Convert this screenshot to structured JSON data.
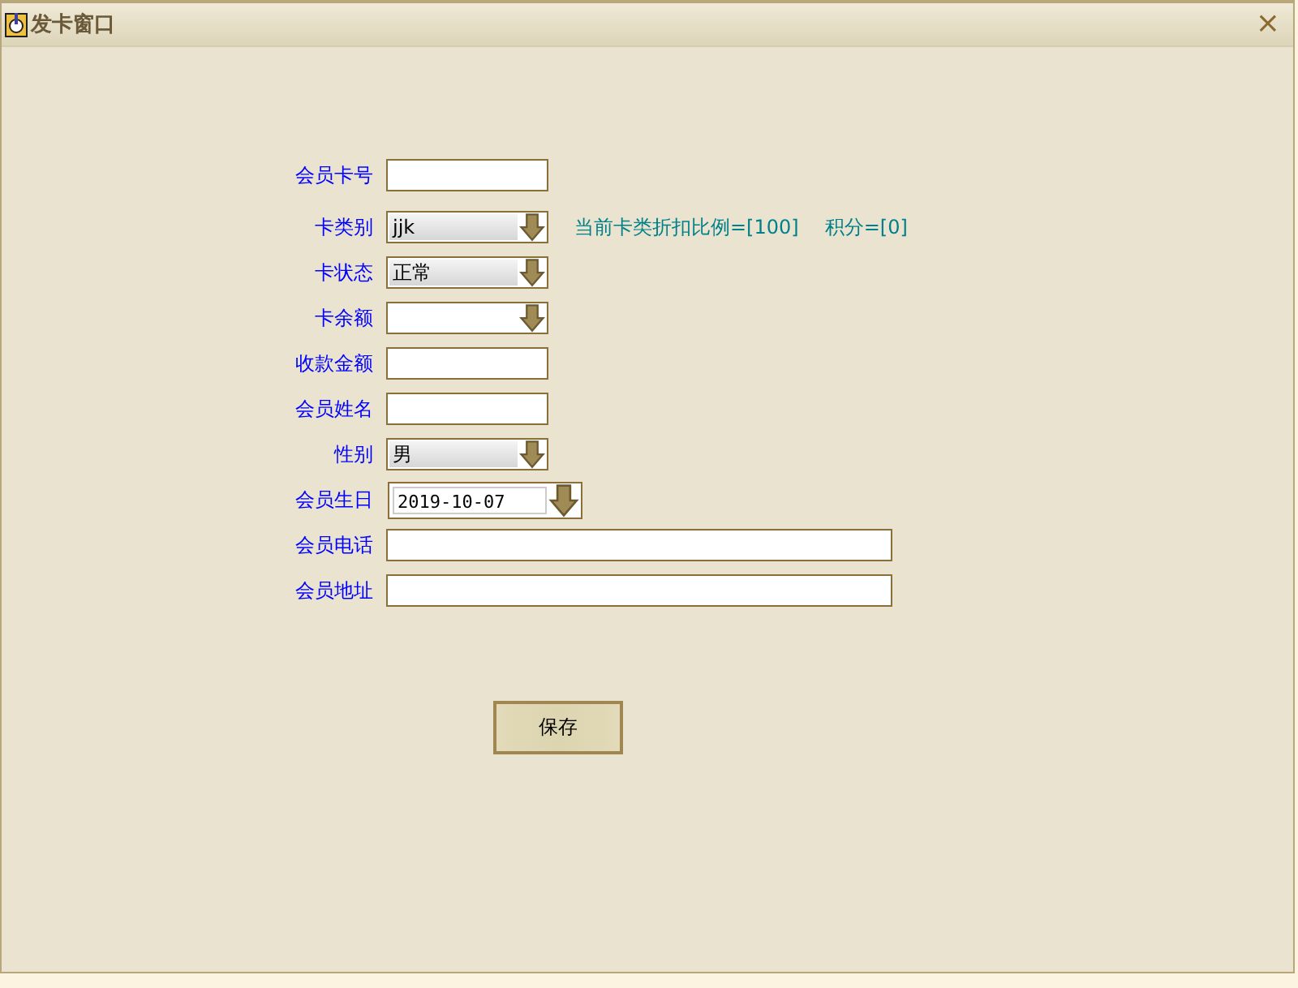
{
  "window": {
    "title": "发卡窗口",
    "close": "×"
  },
  "fields": [
    {
      "label": "会员卡号",
      "kind": "text"
    },
    {
      "label": "卡类别",
      "kind": "select",
      "value": "jjk",
      "notes": [
        "当前卡类折扣比例=[100]",
        "积分=[0]"
      ]
    },
    {
      "label": "卡状态",
      "kind": "select",
      "value": "正常"
    },
    {
      "label": "卡余额",
      "kind": "select"
    },
    {
      "label": "收款金额",
      "kind": "text"
    },
    {
      "label": "会员姓名",
      "kind": "text"
    },
    {
      "label": "性别",
      "kind": "select",
      "value": "男"
    },
    {
      "label": "会员生日",
      "kind": "date",
      "value": "2019-10-07"
    },
    {
      "label": "会员电话",
      "kind": "wide"
    },
    {
      "label": "会员地址",
      "kind": "wide"
    }
  ],
  "buttons": [
    "保存"
  ]
}
